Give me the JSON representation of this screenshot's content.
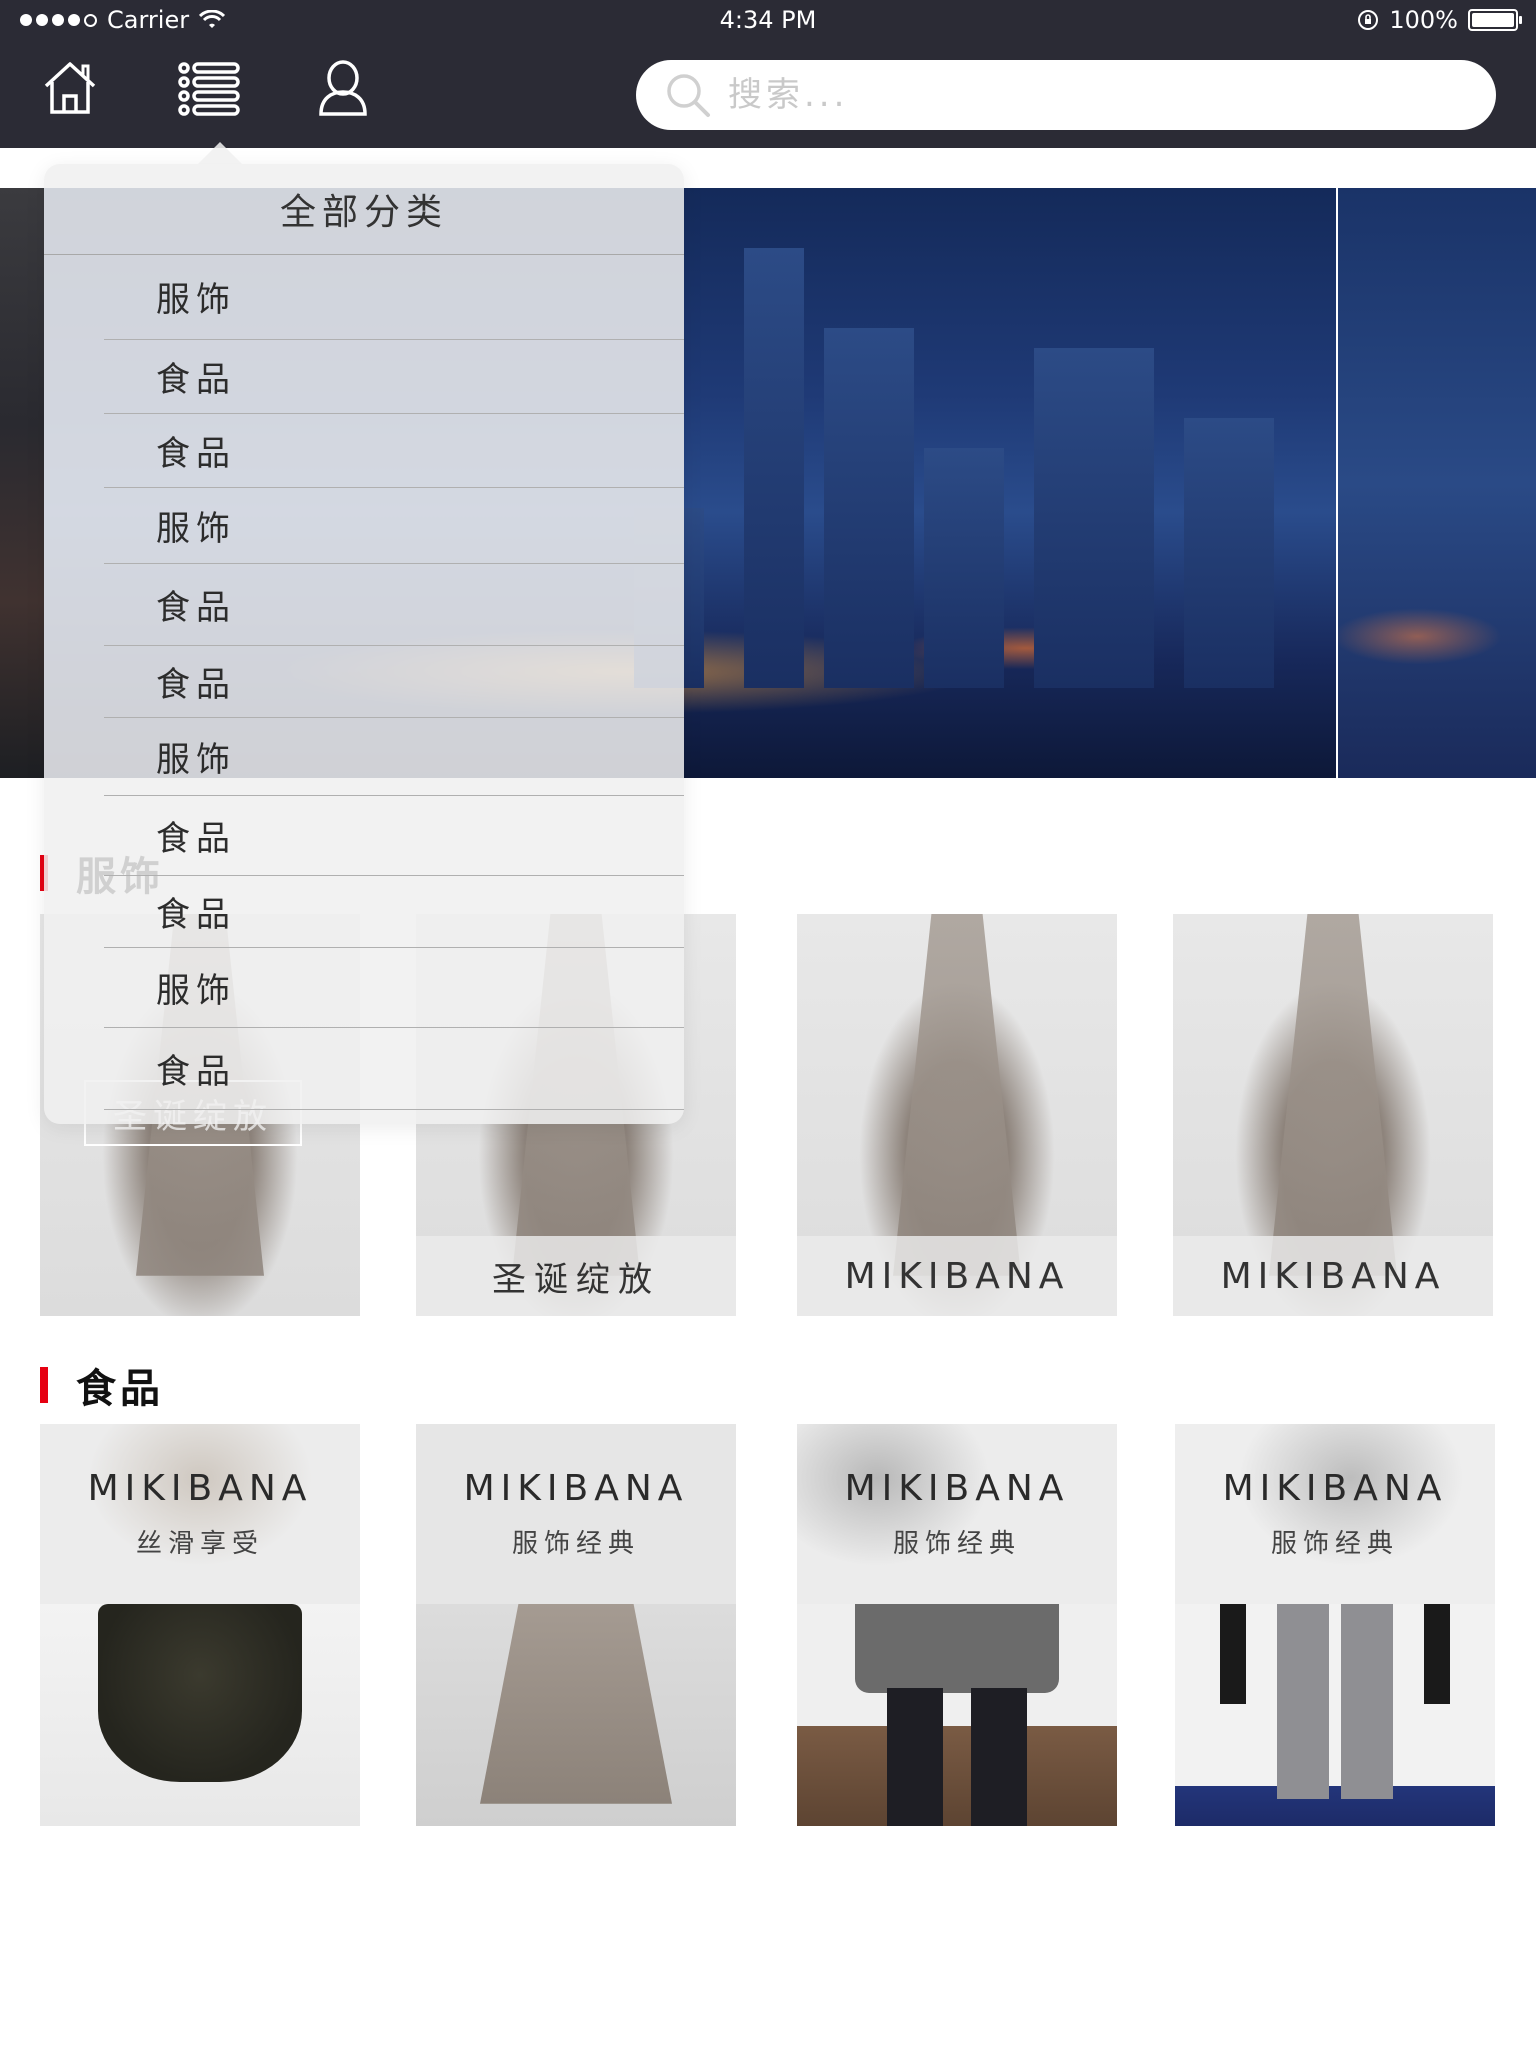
{
  "status_bar": {
    "carrier": "Carrier",
    "time": "4:34 PM",
    "battery": "100%",
    "battery_level": 1.0
  },
  "nav": {
    "icons": [
      "home-icon",
      "menu-list-icon",
      "user-icon"
    ],
    "search_placeholder": "搜索..."
  },
  "dropdown": {
    "title": "全部分类",
    "items": [
      "服饰",
      "食品",
      "食品",
      "服饰",
      "食品",
      "食品",
      "服饰",
      "食品",
      "食品",
      "服饰",
      "食品"
    ]
  },
  "sections": [
    {
      "title": "服饰",
      "cards": [
        {
          "caption": "圣诞绽放"
        },
        {
          "caption": "圣诞绽放"
        },
        {
          "caption": "MIKIBANA"
        },
        {
          "caption": "MIKIBANA"
        }
      ]
    },
    {
      "title": "食品",
      "cards": [
        {
          "brand": "MIKIBANA",
          "subtitle": "丝滑享受"
        },
        {
          "brand": "MIKIBANA",
          "subtitle": "服饰经典"
        },
        {
          "brand": "MIKIBANA",
          "subtitle": "服饰经典"
        },
        {
          "brand": "MIKIBANA",
          "subtitle": "服饰经典"
        }
      ]
    }
  ],
  "colors": {
    "nav_bg": "#2b2b35",
    "accent": "#e60012"
  }
}
